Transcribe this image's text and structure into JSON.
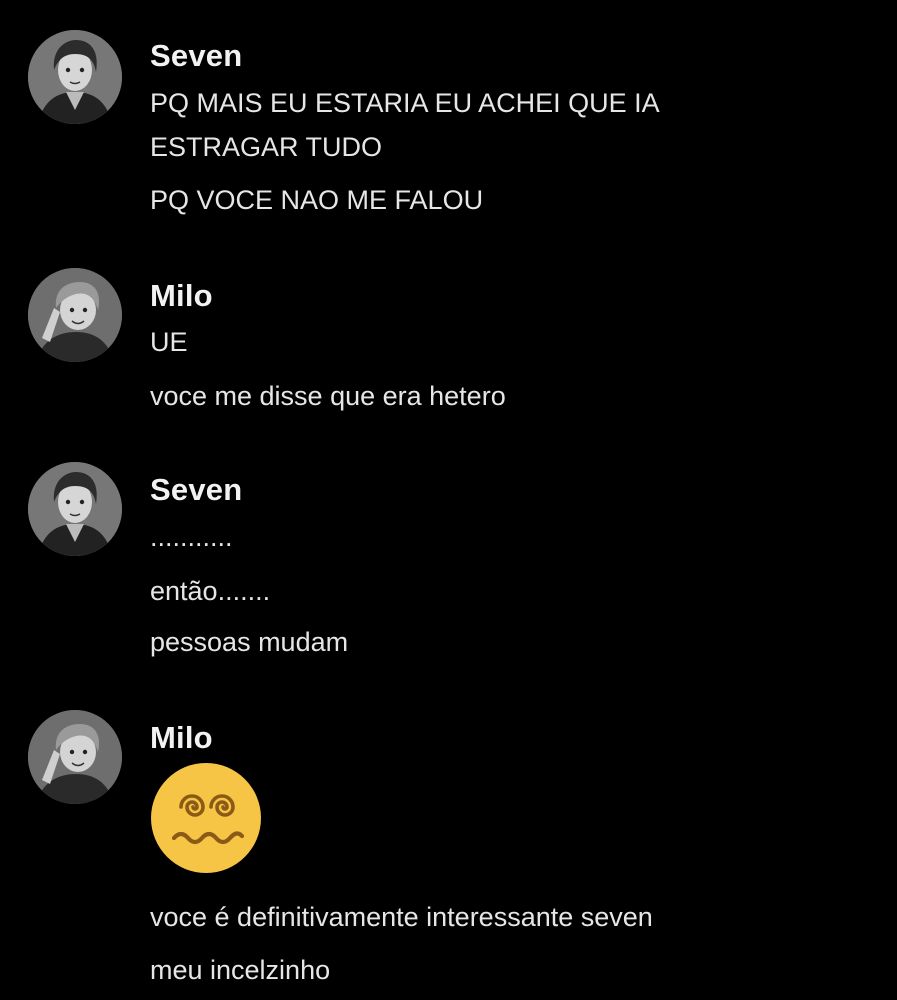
{
  "messages": [
    {
      "author": "Seven",
      "lines": [
        "PQ MAIS EU ESTARIA EU ACHEI QUE IA",
        "ESTRAGAR TUDO",
        "PQ VOCE NAO ME FALOU"
      ]
    },
    {
      "author": "Milo",
      "lines": [
        "UE",
        "voce me disse que era hetero"
      ]
    },
    {
      "author": "Seven",
      "lines": [
        "...........",
        "então.......",
        "pessoas mudam"
      ]
    },
    {
      "author": "Milo",
      "emoji": "face-with-spiral-eyes-woozy-icon",
      "lines": [
        "voce é definitivamente interessante seven",
        "meu incelzinho"
      ]
    }
  ],
  "colors": {
    "background": "#000000",
    "username": "#f2f2f2",
    "text": "#e6e6e6",
    "emoji_face": "#f6c545",
    "emoji_features": "#8a5a16"
  }
}
